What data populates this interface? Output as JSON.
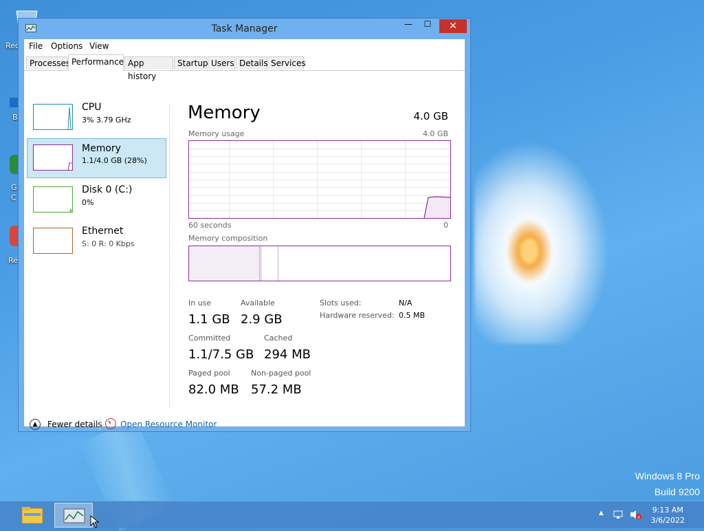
{
  "desktop": {
    "icon_labels": [
      "Rec",
      "B",
      "G",
      "C",
      "Re"
    ],
    "watermark_line1": "Windows 8 Pro",
    "watermark_line2": "Build 9200"
  },
  "window": {
    "title": "Task Manager",
    "minimize": "—",
    "maximize": "☐",
    "close": "✕"
  },
  "menu": [
    "File",
    "Options",
    "View"
  ],
  "tabs": [
    "Processes",
    "Performance",
    "App history",
    "Startup",
    "Users",
    "Details",
    "Services"
  ],
  "active_tab": "Performance",
  "perf_items": [
    {
      "name": "CPU",
      "detail": "3% 3.79 GHz",
      "color": "#1a8fa8"
    },
    {
      "name": "Memory",
      "detail": "1.1/4.0 GB (28%)",
      "color": "#8e2a9c"
    },
    {
      "name": "Disk 0 (C:)",
      "detail": "0%",
      "color": "#4da731"
    },
    {
      "name": "Ethernet",
      "detail": "S: 0 R: 0 Kbps",
      "color": "#a7652a"
    }
  ],
  "memory": {
    "title": "Memory",
    "total": "4.0 GB",
    "usage_label": "Memory usage",
    "usage_max": "4.0 GB",
    "time_label": "60 seconds",
    "time_end": "0",
    "composition_label": "Memory composition",
    "usage_fraction_recent": 0.28,
    "stats": {
      "in_use_label": "In use",
      "in_use": "1.1 GB",
      "available_label": "Available",
      "available": "2.9 GB",
      "committed_label": "Committed",
      "committed": "1.1/7.5 GB",
      "cached_label": "Cached",
      "cached": "294 MB",
      "paged_label": "Paged pool",
      "paged": "82.0 MB",
      "nonpaged_label": "Non-paged pool",
      "nonpaged": "57.2 MB",
      "slots_label": "Slots used:",
      "slots": "N/A",
      "hwres_label": "Hardware reserved:",
      "hwres": "0.5 MB"
    }
  },
  "footer": {
    "fewer_details": "Fewer details",
    "open_resource_monitor": "Open Resource Monitor"
  },
  "taskbar": {
    "time": "9:13 AM",
    "date": "3/6/2022",
    "apps": [
      "file-explorer-icon",
      "task-manager-icon"
    ]
  }
}
